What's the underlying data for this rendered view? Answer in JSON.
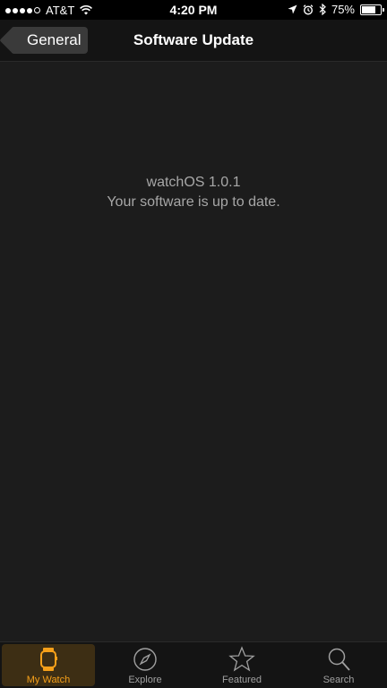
{
  "status_bar": {
    "carrier": "AT&T",
    "time": "4:20 PM",
    "battery_percent": "75%",
    "battery_level": 0.75,
    "icons": [
      "signal-dots",
      "wifi-icon",
      "location-icon",
      "alarm-icon",
      "bluetooth-icon",
      "battery-icon"
    ]
  },
  "nav": {
    "back_label": "General",
    "title": "Software Update"
  },
  "content": {
    "version": "watchOS 1.0.1",
    "message": "Your software is up to date."
  },
  "tabs": [
    {
      "label": "My Watch",
      "icon": "watch-icon",
      "active": true
    },
    {
      "label": "Explore",
      "icon": "compass-icon",
      "active": false
    },
    {
      "label": "Featured",
      "icon": "star-icon",
      "active": false
    },
    {
      "label": "Search",
      "icon": "search-icon",
      "active": false
    }
  ],
  "colors": {
    "accent": "#f6a01a",
    "background": "#1c1c1c",
    "text_secondary": "#a7a7a7"
  }
}
